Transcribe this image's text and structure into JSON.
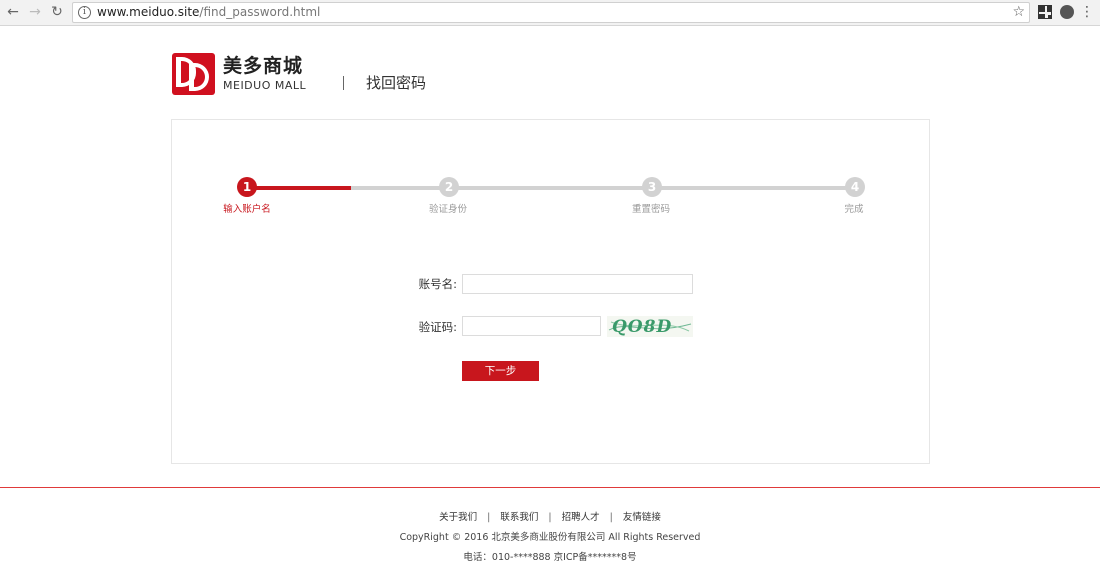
{
  "browser": {
    "url_host": "www.meiduo.site",
    "url_path": "/find_password.html"
  },
  "header": {
    "brand_cn": "美多商城",
    "brand_en": "MEIDUO MALL",
    "page_title": "找回密码"
  },
  "steps": [
    {
      "number": "1",
      "label": "输入账户名"
    },
    {
      "number": "2",
      "label": "验证身份"
    },
    {
      "number": "3",
      "label": "重置密码"
    },
    {
      "number": "4",
      "label": "完成"
    }
  ],
  "current_step": 1,
  "form": {
    "username_label": "账号名:",
    "username_value": "",
    "captcha_label": "验证码:",
    "captcha_value": "",
    "captcha_image_text": "QO8D",
    "next_label": "下一步"
  },
  "footer": {
    "links": [
      "关于我们",
      "联系我们",
      "招聘人才",
      "友情链接"
    ],
    "copyright": "CopyRight © 2016 北京美多商业股份有限公司 All Rights Reserved",
    "contact": "电话：010-****888    京ICP备*******8号"
  },
  "colors": {
    "brand_red": "#c8161d",
    "inactive_gray": "#d2d2d2"
  }
}
